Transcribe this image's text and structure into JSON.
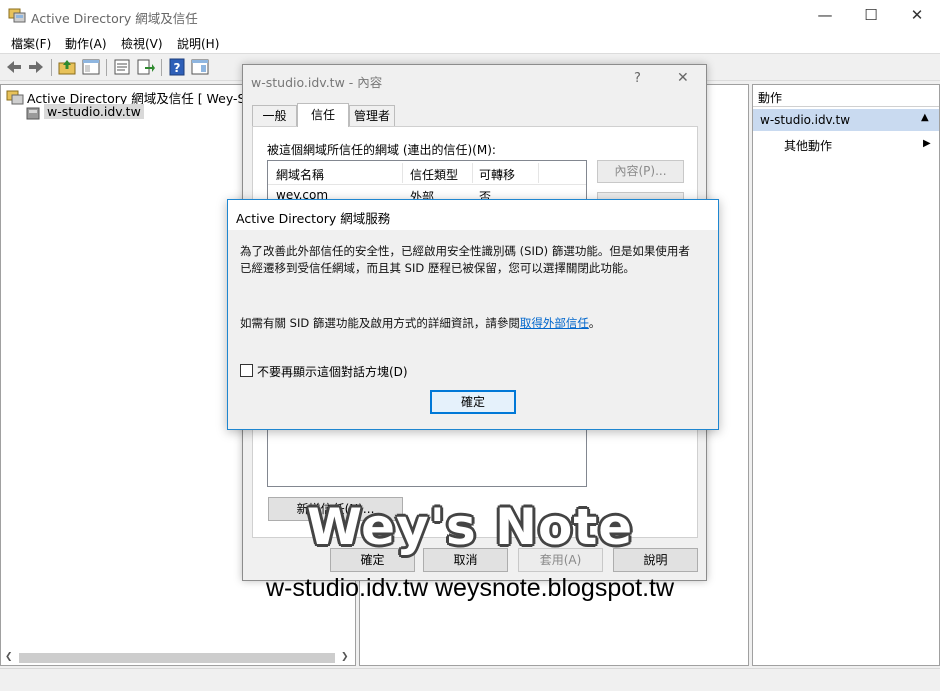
{
  "window": {
    "title": "Active Directory 網域及信任",
    "minimize": "—",
    "maximize": "☐",
    "close": "✕"
  },
  "menu": [
    "檔案(F)",
    "動作(A)",
    "檢視(V)",
    "說明(H)"
  ],
  "toolbar": {
    "icons": [
      "back-icon",
      "forward-icon",
      "up-folder-icon",
      "show-hide-tree-icon",
      "properties-icon",
      "export-list-icon",
      "help-icon",
      "show-action-pane-icon"
    ]
  },
  "tree": {
    "root_label": "Active Directory 網域及信任 [ Wey-Serv",
    "child_label": "w-studio.idv.tw"
  },
  "actions": {
    "header": "動作",
    "section": "w-studio.idv.tw",
    "section_arrow": "▲",
    "item": "其他動作",
    "item_arrow": "▶"
  },
  "props_dialog": {
    "title": "w-studio.idv.tw - 內容",
    "help": "?",
    "close": "✕",
    "tabs": [
      "一般",
      "信任",
      "管理者"
    ],
    "active_tab": 1,
    "outgoing_label": "被這個網域所信任的網域 (連出的信任)(M):",
    "columns": [
      "網域名稱",
      "信任類型",
      "可轉移"
    ],
    "rows": [
      {
        "domain": "wey.com",
        "type": "外部",
        "transitive": "否"
      }
    ],
    "properties_button": "內容(P)...",
    "new_trust_button": "新增信任(N)...",
    "ok": "確定",
    "cancel": "取消",
    "apply": "套用(A)",
    "help_button": "說明"
  },
  "message_box": {
    "title": "Active Directory 網域服務",
    "line1": "為了改善此外部信任的安全性，已經啟用安全性識別碼 (SID) 篩選功能。但是如果使用者",
    "line2": "已經遷移到受信任網域，而且其 SID 歷程已被保留，您可以選擇關閉此功能。",
    "info_prefix": "如需有關 SID 篩選功能及啟用方式的詳細資訊，請參閱",
    "info_link": "取得外部信任",
    "info_suffix": "。",
    "checkbox_label": "不要再顯示這個對話方塊(D)",
    "checkbox_checked": false,
    "ok": "確定"
  },
  "watermark": {
    "title": "Wey's Note",
    "subtitle": "w-studio.idv.tw  weysnote.blogspot.tw"
  },
  "colors": {
    "accent": "#1e86d0",
    "selection": "#c9daf0",
    "link": "#0066cc"
  }
}
